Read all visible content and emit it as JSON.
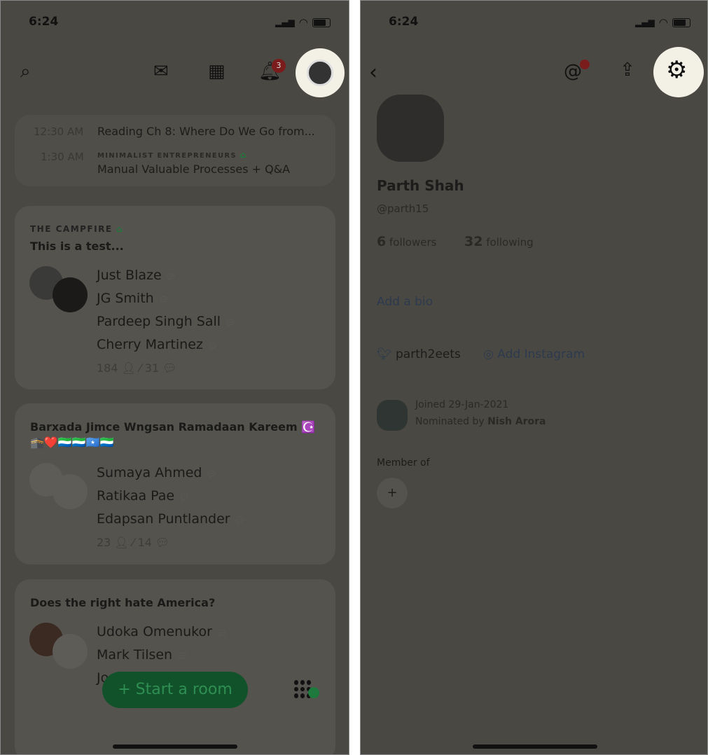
{
  "left": {
    "status_time": "6:24",
    "notification_count": "3",
    "upcoming": [
      {
        "time": "12:30 AM",
        "club": "",
        "title": "Reading Ch 8: Where Do We Go from..."
      },
      {
        "time": "1:30 AM",
        "club": "MINIMALIST ENTREPRENEURS",
        "title": "Manual Valuable Processes + Q&A"
      }
    ],
    "rooms": [
      {
        "club": "THE CAMPFIRE",
        "title": "This is a test...",
        "speakers": [
          "Just Blaze",
          "JG Smith",
          "Pardeep Singh Sall",
          "Cherry Martinez"
        ],
        "listeners": "184",
        "speakers_count": "31"
      },
      {
        "club": "",
        "title": "Barxada Jimce Wngsan Ramadaan Kareem ☪️",
        "emoji": "🕋❤️🇸🇱🇸🇱🇸🇴🇸🇱",
        "speakers": [
          "Sumaya Ahmed",
          "Ratikaa Pae",
          "Edapsan Puntlander"
        ],
        "listeners": "23",
        "speakers_count": "14"
      },
      {
        "club": "",
        "title": "Does the right hate America?",
        "speakers": [
          "Udoka Omenukor",
          "Mark Tilsen",
          "Jo"
        ]
      }
    ],
    "start_room_label": "+ Start a room",
    "accent": "#1e7a3c"
  },
  "right": {
    "status_time": "6:24",
    "name": "Parth Shah",
    "handle": "@parth15",
    "followers_count": "6",
    "followers_label": "followers",
    "following_count": "32",
    "following_label": "following",
    "add_bio": "Add a bio",
    "twitter": "parth2eets",
    "instagram": "Add Instagram",
    "joined": "Joined 29-Jan-2021",
    "nominated_prefix": "Nominated by ",
    "nominated_by": "Nish Arora",
    "member_of": "Member of",
    "add_club": "+"
  }
}
